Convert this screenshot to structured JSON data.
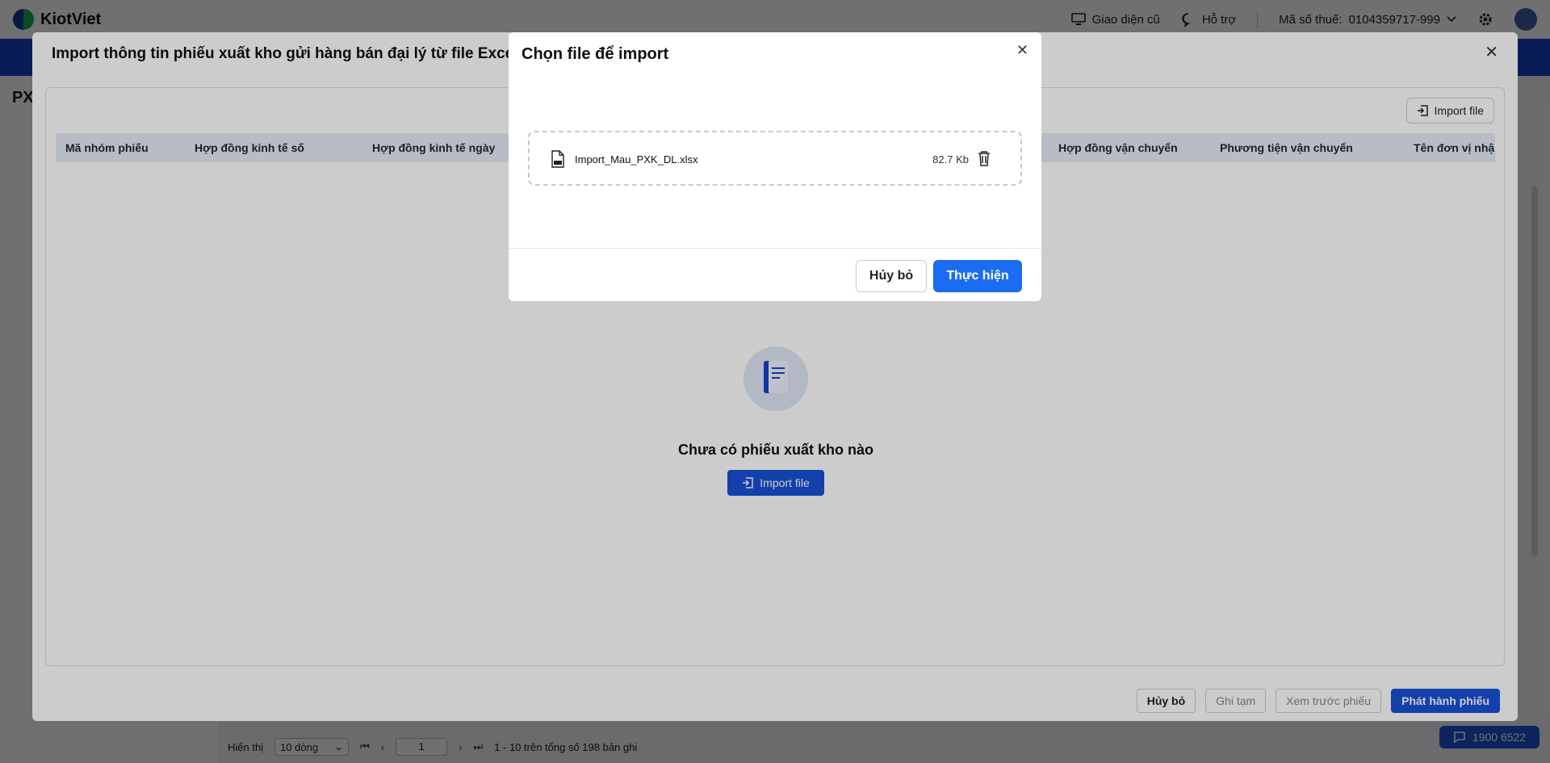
{
  "topbar": {
    "brand": "KiotViet",
    "old_ui": "Giao diện cũ",
    "support": "Hỗ trợ",
    "tax_label": "Mã số thuế:",
    "tax_value": "0104359717-999"
  },
  "page": {
    "title_partial": "PX"
  },
  "pager": {
    "show_label": "Hiển thị",
    "rows_option": "10 dòng",
    "page_value": "1",
    "summary": "1 - 10 trên tổng số 198 bản ghi"
  },
  "hotline": "1900 6522",
  "import_modal": {
    "title": "Import thông tin phiếu xuất kho gửi hàng bán đại lý từ file Excel",
    "import_button": "Import file",
    "columns": [
      "Mã nhóm phiếu",
      "Hợp đồng kinh tế số",
      "Hợp đồng kinh tế ngày",
      "Hợp đồng vận chuyển",
      "Phương tiện vận chuyển",
      "Tên đơn vị nhận"
    ],
    "empty_text": "Chưa có phiếu xuất kho nào",
    "empty_import_button": "Import file",
    "footer": {
      "cancel": "Hủy bỏ",
      "save_draft": "Ghi tạm",
      "preview": "Xem trước phiếu",
      "publish": "Phát hành phiếu"
    }
  },
  "file_modal": {
    "title": "Chọn file để import",
    "file_name": "Import_Mau_PXK_DL.xlsx",
    "file_size": "82.7 Kb",
    "cancel": "Hủy bỏ",
    "confirm": "Thực hiện"
  },
  "colors": {
    "brand_blue": "#1740c9",
    "primary_button": "#1a6cf0",
    "secondary_primary": "#1a50d8"
  }
}
